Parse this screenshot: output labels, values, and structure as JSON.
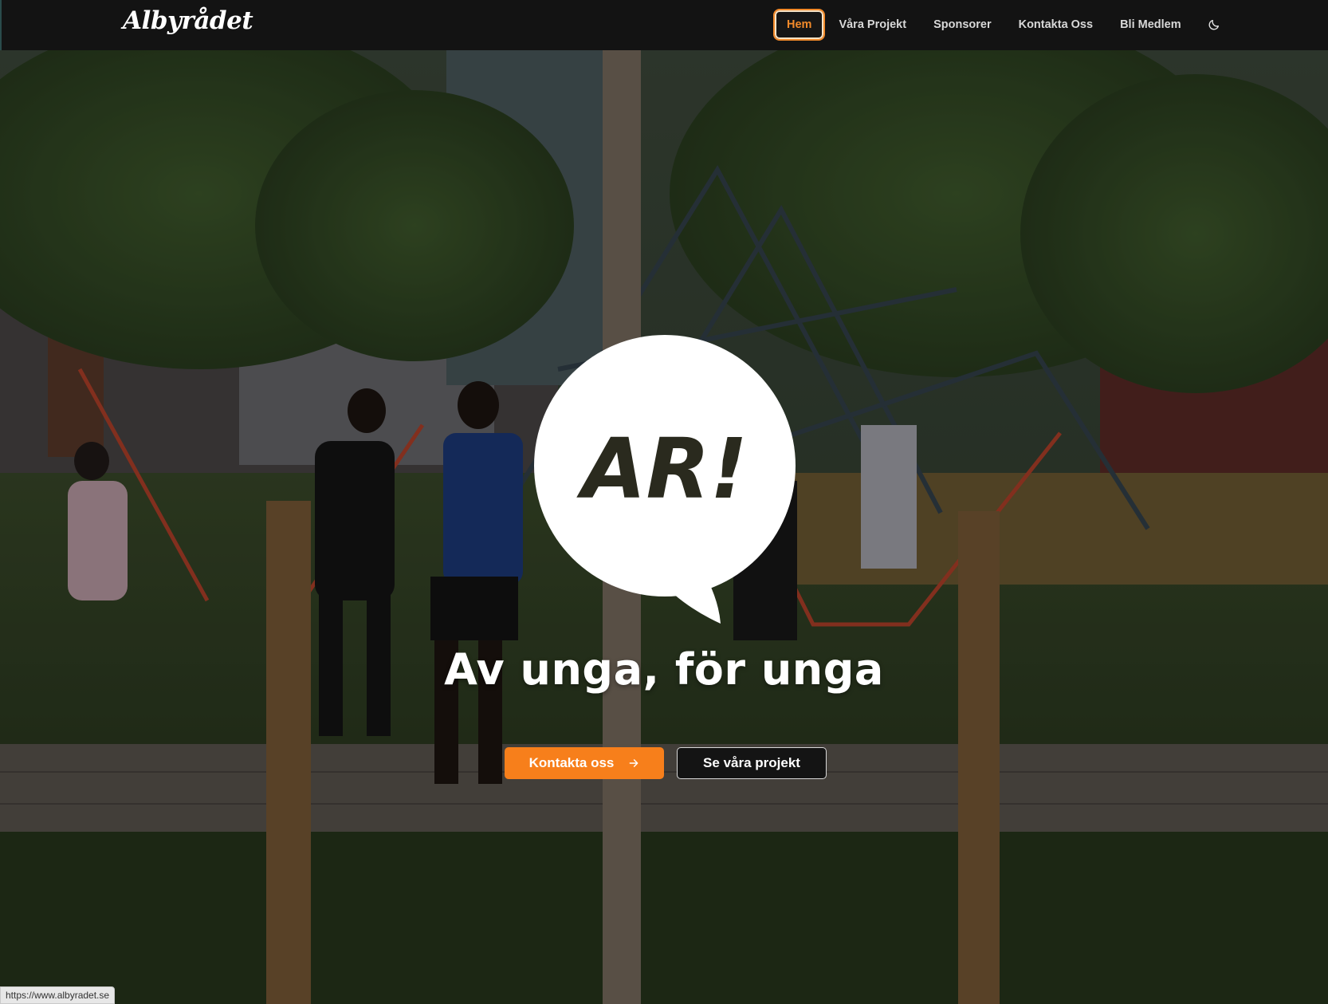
{
  "navbar": {
    "logo_text": "Albyrådet",
    "items": [
      {
        "label": "Hem",
        "active": true
      },
      {
        "label": "Våra Projekt",
        "active": false
      },
      {
        "label": "Sponsorer",
        "active": false
      },
      {
        "label": "Kontakta Oss",
        "active": false
      },
      {
        "label": "Bli Medlem",
        "active": false
      }
    ],
    "theme_toggle_icon": "moon-icon"
  },
  "hero": {
    "bubble_logo_text": "AR!",
    "tagline": "Av unga, för unga",
    "primary_cta": {
      "label": "Kontakta oss",
      "icon": "arrow-right-icon"
    },
    "secondary_cta": {
      "label": "Se våra projekt"
    }
  },
  "status_bar": {
    "url": "https://www.albyradet.se"
  },
  "colors": {
    "accent": "#f77f1b",
    "nav_bg": "#131313",
    "text": "#ffffff"
  }
}
